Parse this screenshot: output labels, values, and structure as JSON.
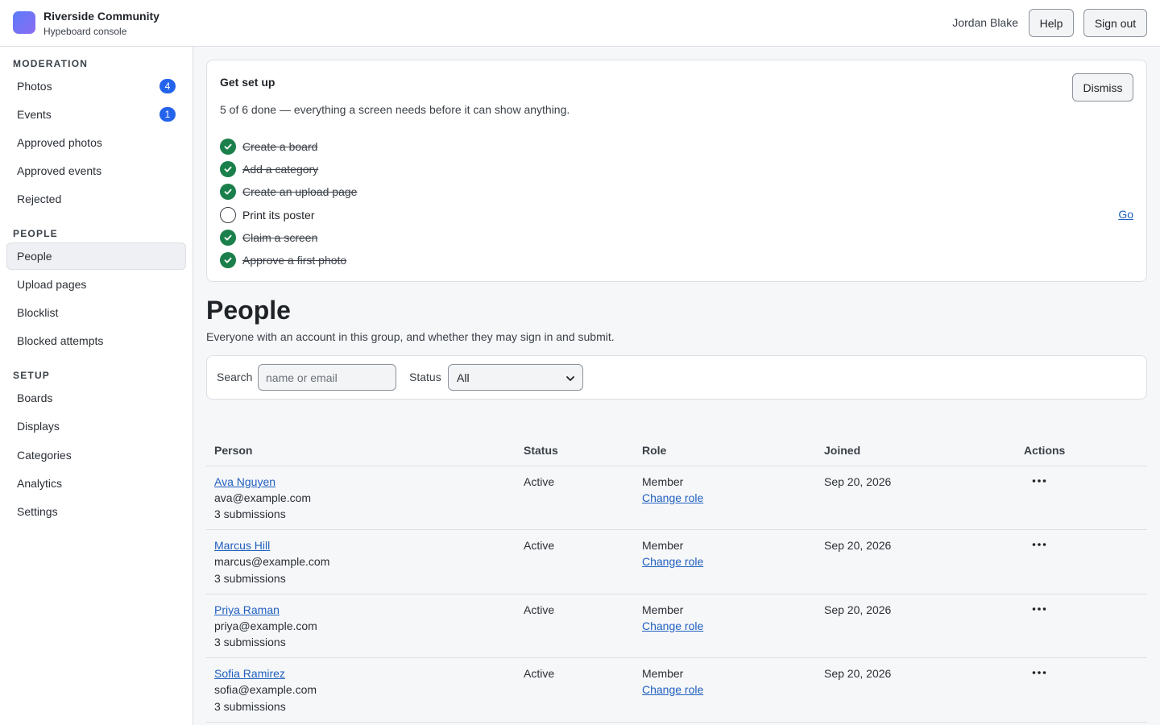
{
  "header": {
    "org_name": "Riverside Community",
    "org_sub": "Hypeboard console",
    "user_name": "Jordan Blake",
    "help_label": "Help",
    "signout_label": "Sign out"
  },
  "sidebar": {
    "sections": [
      {
        "heading": "MODERATION",
        "items": [
          {
            "label": "Photos",
            "badge": "4"
          },
          {
            "label": "Events",
            "badge": "1"
          },
          {
            "label": "Approved photos"
          },
          {
            "label": "Approved events"
          },
          {
            "label": "Rejected"
          }
        ]
      },
      {
        "heading": "PEOPLE",
        "items": [
          {
            "label": "People",
            "active": true
          },
          {
            "label": "Upload pages"
          },
          {
            "label": "Blocklist"
          },
          {
            "label": "Blocked attempts"
          }
        ]
      },
      {
        "heading": "SETUP",
        "items": [
          {
            "label": "Boards"
          },
          {
            "label": "Displays"
          },
          {
            "label": "Categories"
          },
          {
            "label": "Analytics"
          },
          {
            "label": "Settings"
          }
        ]
      }
    ]
  },
  "setup": {
    "title": "Get set up",
    "progress": "5 of 6 done — everything a screen needs before it can show anything.",
    "dismiss_label": "Dismiss",
    "steps": [
      {
        "label": "Create a board",
        "done": true
      },
      {
        "label": "Add a category",
        "done": true
      },
      {
        "label": "Create an upload page",
        "done": true
      },
      {
        "label": "Print its poster",
        "done": false
      },
      {
        "label": "Claim a screen",
        "done": true
      },
      {
        "label": "Approve a first photo",
        "done": true
      }
    ],
    "go_label": "Go"
  },
  "page": {
    "title": "People",
    "description": "Everyone with an account in this group, and whether they may sign in and submit."
  },
  "filters": {
    "search_label": "Search",
    "search_placeholder": "name or email",
    "status_label": "Status",
    "status_value": "All"
  },
  "table": {
    "columns": [
      "Person",
      "Status",
      "Role",
      "Joined",
      "Actions"
    ],
    "rows": [
      {
        "name": "Ava Nguyen",
        "email": "ava@example.com",
        "submissions": "3 submissions",
        "status": "Active",
        "role": "Member",
        "change_role": "Change role",
        "joined": "Sep 20, 2026"
      },
      {
        "name": "Marcus Hill",
        "email": "marcus@example.com",
        "submissions": "3 submissions",
        "status": "Active",
        "role": "Member",
        "change_role": "Change role",
        "joined": "Sep 20, 2026"
      },
      {
        "name": "Priya Raman",
        "email": "priya@example.com",
        "submissions": "3 submissions",
        "status": "Active",
        "role": "Member",
        "change_role": "Change role",
        "joined": "Sep 20, 2026"
      },
      {
        "name": "Sofia Ramirez",
        "email": "sofia@example.com",
        "submissions": "3 submissions",
        "status": "Active",
        "role": "Member",
        "change_role": "Change role",
        "joined": "Sep 20, 2026"
      }
    ]
  },
  "colors": {
    "accent": "#2463eb",
    "link": "#1f5fbf",
    "done": "#1a7f4a"
  }
}
